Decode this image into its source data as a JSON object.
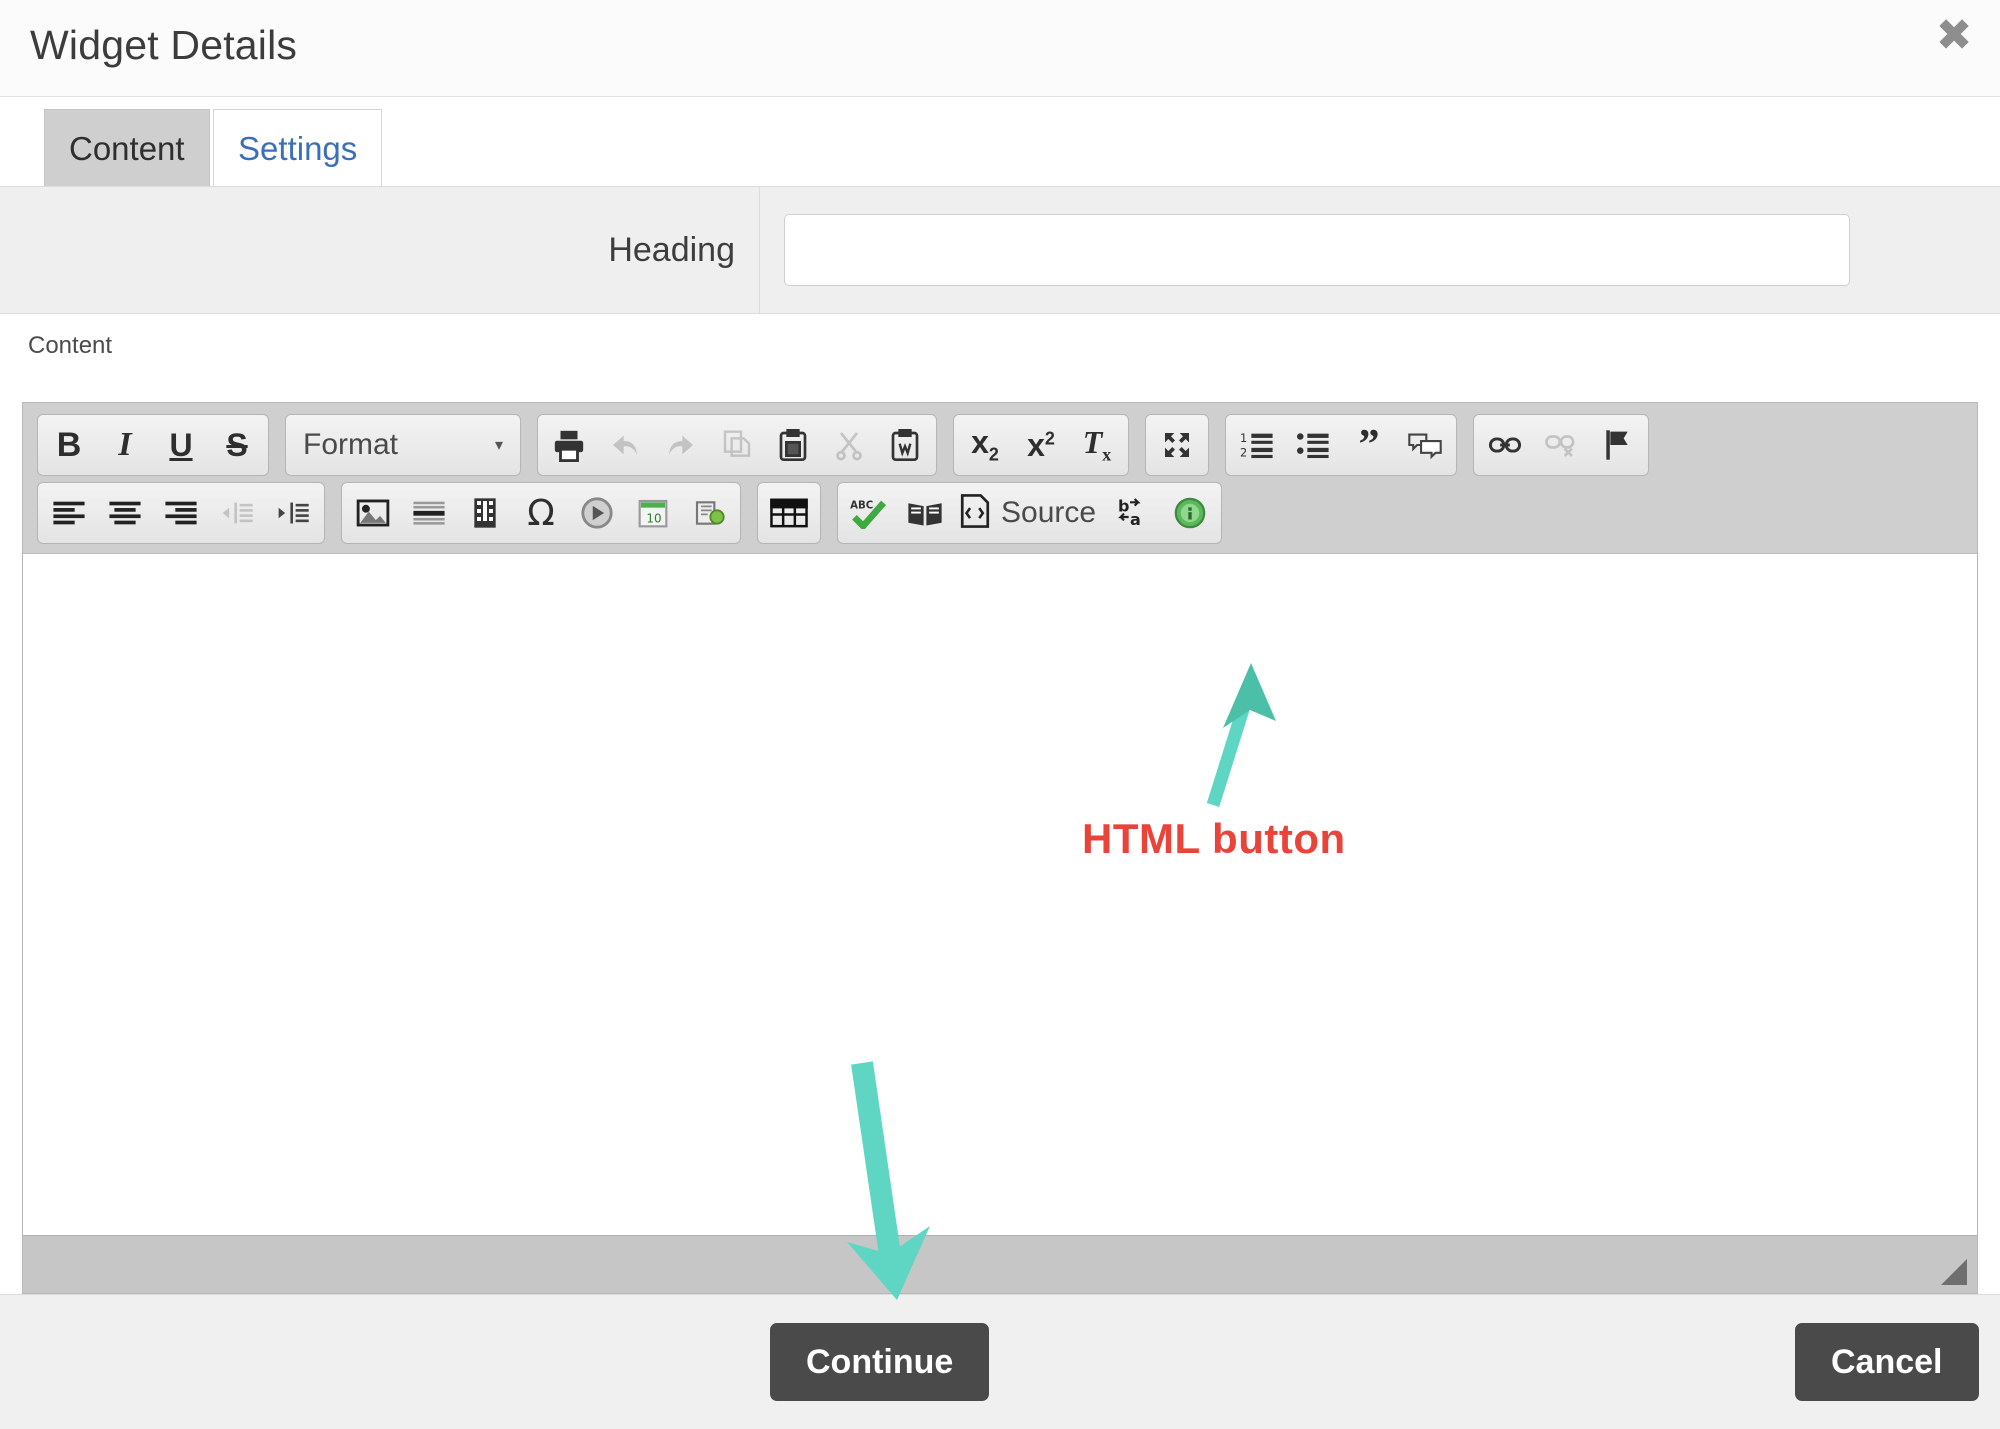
{
  "window": {
    "title": "Widget Details",
    "close_icon": "close-icon"
  },
  "tabs": [
    {
      "label": "Content",
      "active": true
    },
    {
      "label": "Settings",
      "active": false
    }
  ],
  "form": {
    "heading_label": "Heading",
    "heading_value": "",
    "heading_placeholder": ""
  },
  "editor": {
    "field_label": "Content",
    "body_text": "",
    "resize_grip": "resize-grip-icon",
    "toolbar": {
      "row1": [
        {
          "group": "basic-styles",
          "items": [
            {
              "name": "bold-button",
              "glyph": "B"
            },
            {
              "name": "italic-button",
              "glyph": "I"
            },
            {
              "name": "underline-button",
              "glyph": "U"
            },
            {
              "name": "strikethrough-button",
              "glyph": "S"
            }
          ]
        },
        {
          "group": "format-dropdown",
          "label": "Format",
          "caret": "▾"
        },
        {
          "group": "clipboard",
          "items": [
            {
              "name": "print-button",
              "icon": "printer-icon"
            },
            {
              "name": "undo-button",
              "icon": "undo-arrow-icon",
              "disabled": true
            },
            {
              "name": "redo-button",
              "icon": "redo-arrow-icon",
              "disabled": true
            },
            {
              "name": "copy-button",
              "icon": "copy-icon",
              "disabled": true
            },
            {
              "name": "paste-button",
              "icon": "paste-clipboard-icon"
            },
            {
              "name": "cut-button",
              "icon": "scissors-icon",
              "disabled": true
            },
            {
              "name": "paste-from-word-button",
              "icon": "paste-word-icon"
            }
          ]
        },
        {
          "group": "script",
          "items": [
            {
              "name": "subscript-button",
              "icon": "subscript-icon"
            },
            {
              "name": "superscript-button",
              "icon": "superscript-icon"
            },
            {
              "name": "remove-format-button",
              "icon": "remove-format-icon"
            }
          ]
        },
        {
          "group": "maximize",
          "items": [
            {
              "name": "maximize-button",
              "icon": "maximize-icon"
            }
          ]
        },
        {
          "group": "lists",
          "items": [
            {
              "name": "numbered-list-button",
              "icon": "numbered-list-icon"
            },
            {
              "name": "bulleted-list-button",
              "icon": "bulleted-list-icon"
            },
            {
              "name": "blockquote-button",
              "icon": "quote-icon"
            },
            {
              "name": "create-div-button",
              "icon": "speech-bubbles-icon"
            }
          ]
        },
        {
          "group": "links",
          "items": [
            {
              "name": "link-button",
              "icon": "chain-link-icon"
            },
            {
              "name": "unlink-button",
              "icon": "broken-link-icon",
              "disabled": true
            },
            {
              "name": "anchor-button",
              "icon": "flag-icon"
            }
          ]
        }
      ],
      "row2": [
        {
          "group": "alignment",
          "items": [
            {
              "name": "align-left-button",
              "icon": "align-left-icon"
            },
            {
              "name": "align-center-button",
              "icon": "align-center-icon"
            },
            {
              "name": "align-right-button",
              "icon": "align-right-icon"
            },
            {
              "name": "outdent-button",
              "icon": "outdent-icon",
              "disabled": true
            },
            {
              "name": "indent-button",
              "icon": "indent-icon"
            }
          ]
        },
        {
          "group": "insert",
          "items": [
            {
              "name": "insert-image-button",
              "icon": "image-icon"
            },
            {
              "name": "horizontal-rule-button",
              "icon": "horizontal-rule-icon"
            },
            {
              "name": "insert-flash-button",
              "icon": "film-strip-icon"
            },
            {
              "name": "special-character-button",
              "icon": "omega-icon",
              "glyph": "Ω"
            },
            {
              "name": "page-break-button",
              "icon": "page-break-icon"
            },
            {
              "name": "insert-date-button",
              "icon": "calendar-icon"
            },
            {
              "name": "insert-template-button",
              "icon": "templates-icon"
            }
          ]
        },
        {
          "group": "table",
          "items": [
            {
              "name": "insert-table-button",
              "icon": "table-grid-icon"
            }
          ]
        },
        {
          "group": "tools",
          "items": [
            {
              "name": "spell-check-button",
              "icon": "spellcheck-abc-icon"
            },
            {
              "name": "dictionary-button",
              "icon": "open-book-icon"
            },
            {
              "name": "source-button",
              "icon": "source-code-icon",
              "label": "Source"
            },
            {
              "name": "text-direction-button",
              "icon": "bidi-text-icon"
            },
            {
              "name": "about-button",
              "icon": "info-circle-icon"
            }
          ]
        }
      ]
    }
  },
  "footer": {
    "continue_label": "Continue",
    "cancel_label": "Cancel"
  },
  "annotations": {
    "callout_text": "HTML button",
    "callout_color": "#e8443a",
    "arrow_color": "#5fd6c4",
    "arrow_to_source": "arrow-pointing-to-source-button",
    "arrow_to_continue": "arrow-pointing-to-continue-button"
  }
}
